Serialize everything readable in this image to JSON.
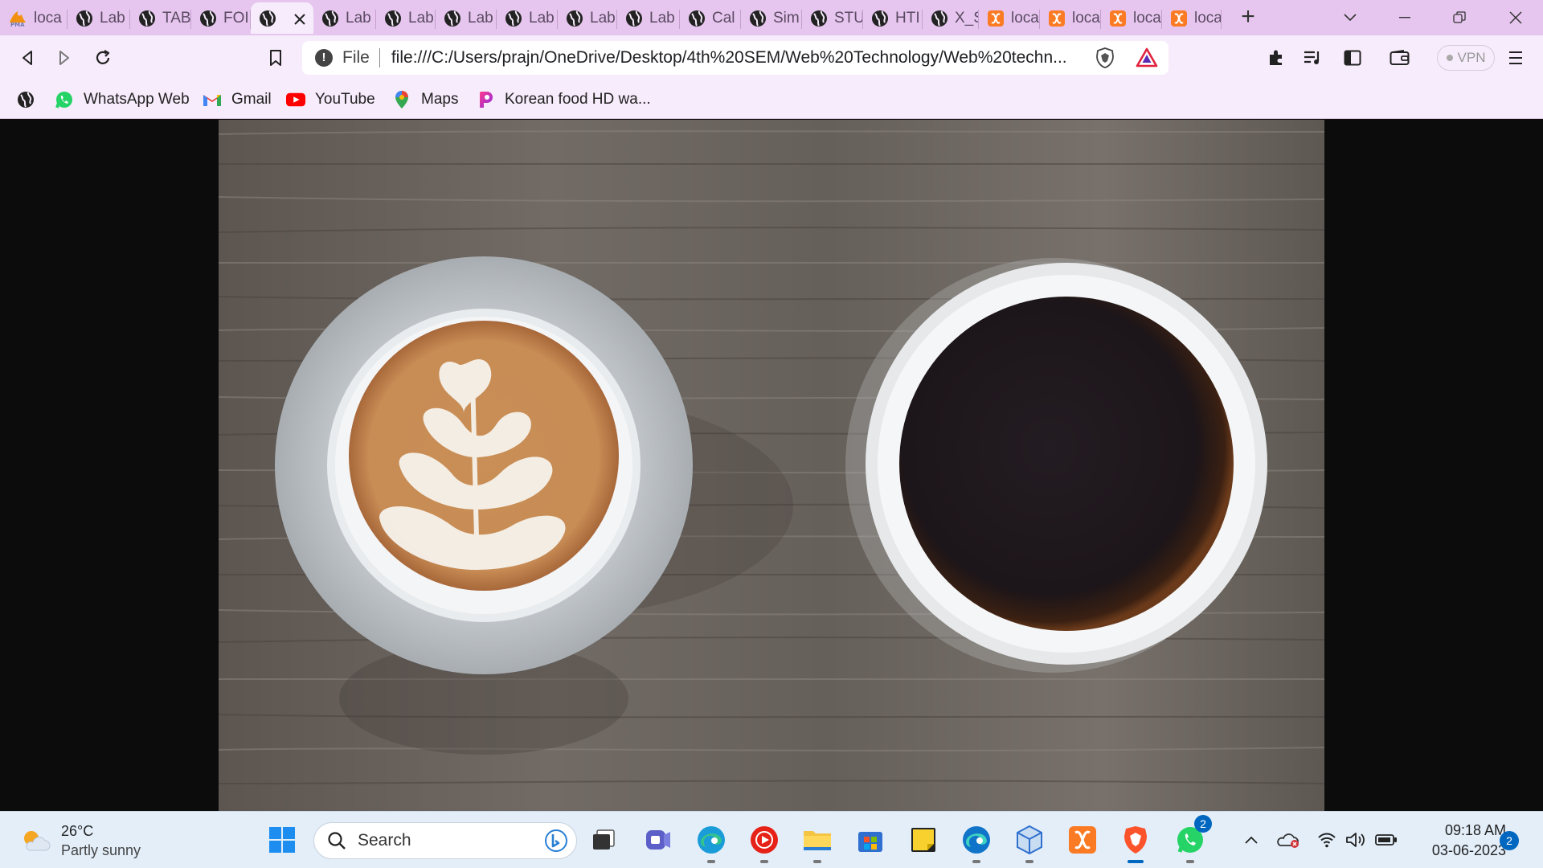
{
  "browser": {
    "tabs": [
      {
        "label": "loca",
        "icon": "phpmyadmin-icon",
        "active": false
      },
      {
        "label": "Lab",
        "icon": "globe-icon",
        "active": false
      },
      {
        "label": "TAB",
        "icon": "globe-icon",
        "active": false
      },
      {
        "label": "FOI",
        "icon": "globe-icon",
        "active": false
      },
      {
        "label": "",
        "icon": "globe-icon",
        "active": true
      },
      {
        "label": "Lab",
        "icon": "globe-icon",
        "active": false
      },
      {
        "label": "Lab",
        "icon": "globe-icon",
        "active": false
      },
      {
        "label": "Lab",
        "icon": "globe-icon",
        "active": false
      },
      {
        "label": "Lab",
        "icon": "globe-icon",
        "active": false
      },
      {
        "label": "Lab",
        "icon": "globe-icon",
        "active": false
      },
      {
        "label": "Lab",
        "icon": "globe-icon",
        "active": false
      },
      {
        "label": "Cal",
        "icon": "globe-icon",
        "active": false
      },
      {
        "label": "Sim",
        "icon": "globe-icon",
        "active": false
      },
      {
        "label": "STU",
        "icon": "globe-icon",
        "active": false
      },
      {
        "label": "HTI",
        "icon": "globe-icon",
        "active": false
      },
      {
        "label": "X_S",
        "icon": "globe-icon",
        "active": false
      },
      {
        "label": "loca",
        "icon": "xampp-icon",
        "active": false
      },
      {
        "label": "loca",
        "icon": "xampp-icon",
        "active": false
      },
      {
        "label": "loca",
        "icon": "xampp-icon",
        "active": false
      },
      {
        "label": "loca",
        "icon": "xampp-icon",
        "active": false
      }
    ],
    "address": {
      "scheme_label": "File",
      "url": "file:///C:/Users/prajn/OneDrive/Desktop/4th%20SEM/Web%20Technology/Web%20techn..."
    },
    "vpn_label": "VPN",
    "bookmarks": [
      {
        "label": "",
        "icon": "globe-icon"
      },
      {
        "label": "WhatsApp Web",
        "icon": "whatsapp-icon"
      },
      {
        "label": "Gmail",
        "icon": "gmail-icon"
      },
      {
        "label": "YouTube",
        "icon": "youtube-icon"
      },
      {
        "label": "Maps",
        "icon": "maps-icon"
      },
      {
        "label": "Korean food HD wa...",
        "icon": "picsart-icon"
      }
    ]
  },
  "content": {
    "image_subject": "two coffee cups on wooden table"
  },
  "taskbar": {
    "weather": {
      "temp": "26°C",
      "desc": "Partly sunny"
    },
    "search_placeholder": "Search",
    "pinned": [
      "windows-start-icon",
      "search",
      "task-view-icon",
      "teams-icon",
      "edge-icon",
      "youtube-music-icon",
      "file-explorer-icon",
      "store-icon",
      "sticky-notes-icon",
      "edge-beta-icon",
      "3d-viewer-icon",
      "xampp-icon",
      "brave-icon",
      "whatsapp-icon"
    ],
    "whatsapp_badge": "2",
    "clock": {
      "time": "09:18 AM",
      "date": "03-06-2023"
    },
    "notifications": "2"
  },
  "colors": {
    "tabstrip": "#e6c6ee",
    "toolbar": "#f7ecfb",
    "taskbar": "#e3eef9"
  }
}
